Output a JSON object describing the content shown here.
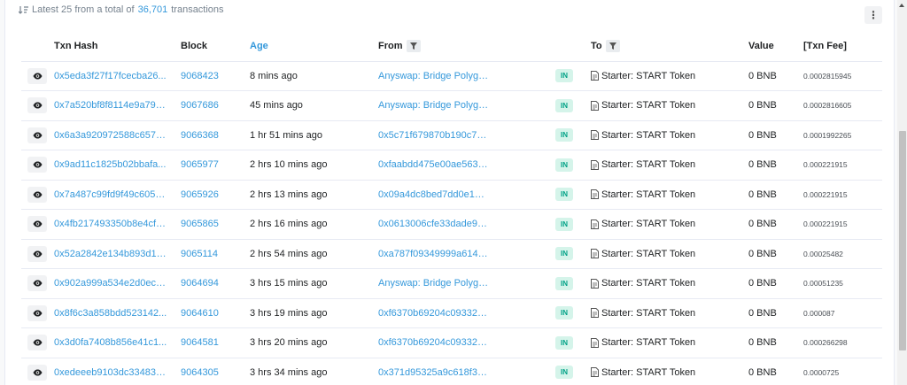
{
  "summary": {
    "prefix": "Latest 25 from a total of",
    "total": "36,701",
    "suffix": "transactions",
    "menu_label": "⋮"
  },
  "columns": {
    "txn_hash": "Txn Hash",
    "block": "Block",
    "age": "Age",
    "from": "From",
    "to": "To",
    "value": "Value",
    "fee": "[Txn Fee]"
  },
  "colors": {
    "link": "#3498db",
    "in_badge_bg": "#d5f4ea",
    "in_badge_text": "#00a186"
  },
  "rows": [
    {
      "hash": "0x5eda3f27f17fcecba26...",
      "block": "9068423",
      "age": "8 mins ago",
      "from": "Anyswap: Bridge Polygon",
      "dir": "IN",
      "to": "Starter: START Token",
      "value": "0 BNB",
      "fee": "0.0002815945"
    },
    {
      "hash": "0x7a520bf8f8114e9a790...",
      "block": "9067686",
      "age": "45 mins ago",
      "from": "Anyswap: Bridge Polygon",
      "dir": "IN",
      "to": "Starter: START Token",
      "value": "0 BNB",
      "fee": "0.0002816605"
    },
    {
      "hash": "0x6a3a920972588c657b...",
      "block": "9066368",
      "age": "1 hr 51 mins ago",
      "from": "0x5c71f679870b190c75...",
      "dir": "IN",
      "to": "Starter: START Token",
      "value": "0 BNB",
      "fee": "0.0001992265"
    },
    {
      "hash": "0x9ad11c1825b02bbafa...",
      "block": "9065977",
      "age": "2 hrs 10 mins ago",
      "from": "0xfaabdd475e00ae563c...",
      "dir": "IN",
      "to": "Starter: START Token",
      "value": "0 BNB",
      "fee": "0.000221915"
    },
    {
      "hash": "0x7a487c99fd9f49c605a...",
      "block": "9065926",
      "age": "2 hrs 13 mins ago",
      "from": "0x09a4dc8bed7dd0e1b7...",
      "dir": "IN",
      "to": "Starter: START Token",
      "value": "0 BNB",
      "fee": "0.000221915"
    },
    {
      "hash": "0x4fb217493350b8e4cf4...",
      "block": "9065865",
      "age": "2 hrs 16 mins ago",
      "from": "0x0613006cfe33dade9a...",
      "dir": "IN",
      "to": "Starter: START Token",
      "value": "0 BNB",
      "fee": "0.000221915"
    },
    {
      "hash": "0x52a2842e134b893d1d...",
      "block": "9065114",
      "age": "2 hrs 54 mins ago",
      "from": "0xa787f09349999a6143...",
      "dir": "IN",
      "to": "Starter: START Token",
      "value": "0 BNB",
      "fee": "0.00025482"
    },
    {
      "hash": "0x902a999a534e2d0ec2...",
      "block": "9064694",
      "age": "3 hrs 15 mins ago",
      "from": "Anyswap: Bridge Polygon",
      "dir": "IN",
      "to": "Starter: START Token",
      "value": "0 BNB",
      "fee": "0.00051235"
    },
    {
      "hash": "0x8f6c3a858bdd523142...",
      "block": "9064610",
      "age": "3 hrs 19 mins ago",
      "from": "0xf6370b69204c09332f0...",
      "dir": "IN",
      "to": "Starter: START Token",
      "value": "0 BNB",
      "fee": "0.000087"
    },
    {
      "hash": "0x3d0fa7408b856e41c1...",
      "block": "9064581",
      "age": "3 hrs 20 mins ago",
      "from": "0xf6370b69204c09332f0...",
      "dir": "IN",
      "to": "Starter: START Token",
      "value": "0 BNB",
      "fee": "0.000266298"
    },
    {
      "hash": "0xedeeeb9103dc334839...",
      "block": "9064305",
      "age": "3 hrs 34 mins ago",
      "from": "0x371d95325a9c618f3d...",
      "dir": "IN",
      "to": "Starter: START Token",
      "value": "0 BNB",
      "fee": "0.0000725"
    }
  ]
}
